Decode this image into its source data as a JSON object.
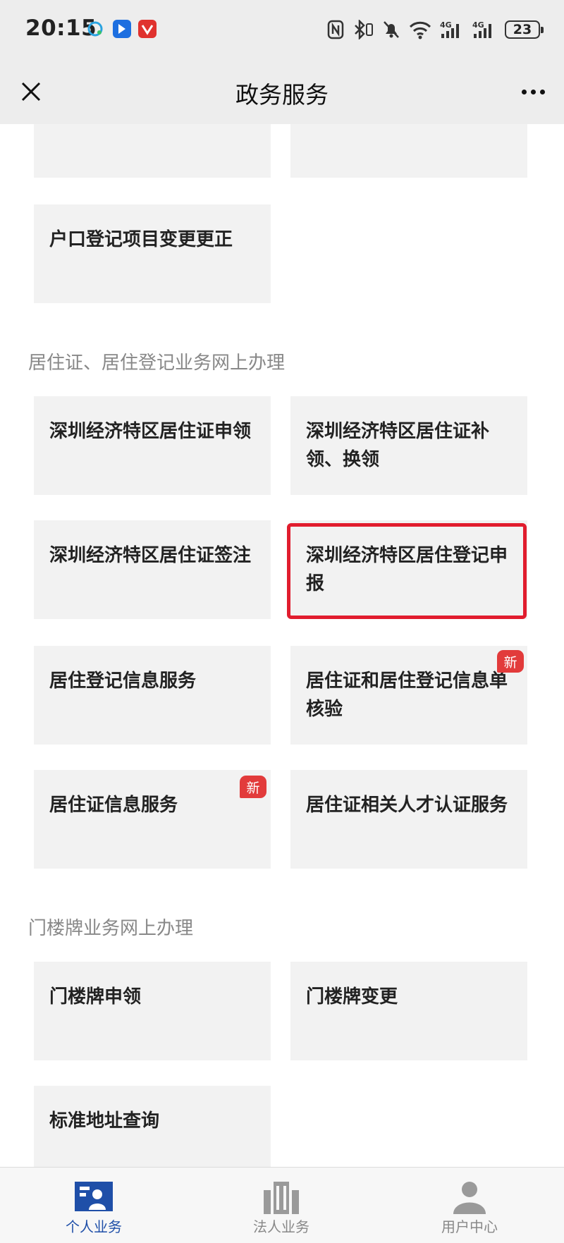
{
  "status_bar": {
    "time": "20:15",
    "battery": "23",
    "icons": [
      "nfc-icon",
      "bluetooth-icon",
      "mute-icon",
      "wifi-icon",
      "signal-4g-icon",
      "signal-4g-icon",
      "battery-icon"
    ]
  },
  "nav": {
    "title": "政务服务",
    "close_icon": "close-icon",
    "more_icon": "more-icon"
  },
  "sections": {
    "hukou": {
      "tiles": [
        "",
        "",
        "户口登记项目变更更正"
      ]
    },
    "residence": {
      "heading": "居住证、居住登记业务网上办理",
      "tiles": [
        "深圳经济特区居住证申领",
        "深圳经济特区居住证补领、换领",
        "深圳经济特区居住证签注",
        "深圳经济特区居住登记申报",
        "居住登记信息服务",
        "居住证和居住登记信息单核验",
        "居住证信息服务",
        "居住证相关人才认证服务"
      ],
      "badge": "新"
    },
    "doorplate": {
      "heading": "门楼牌业务网上办理",
      "tiles": [
        "门楼牌申领",
        "门楼牌变更",
        "标准地址查询"
      ]
    }
  },
  "tabbar": {
    "tabs": [
      {
        "label": "个人业务",
        "icon": "person-card-icon"
      },
      {
        "label": "法人业务",
        "icon": "building-icon"
      },
      {
        "label": "用户中心",
        "icon": "user-icon"
      }
    ],
    "active_color": "#1f4fa8",
    "inactive_color": "#888888"
  },
  "colors": {
    "highlight": "#e11d2e",
    "badge": "#e23b3b",
    "tile_bg": "#f2f2f2"
  }
}
